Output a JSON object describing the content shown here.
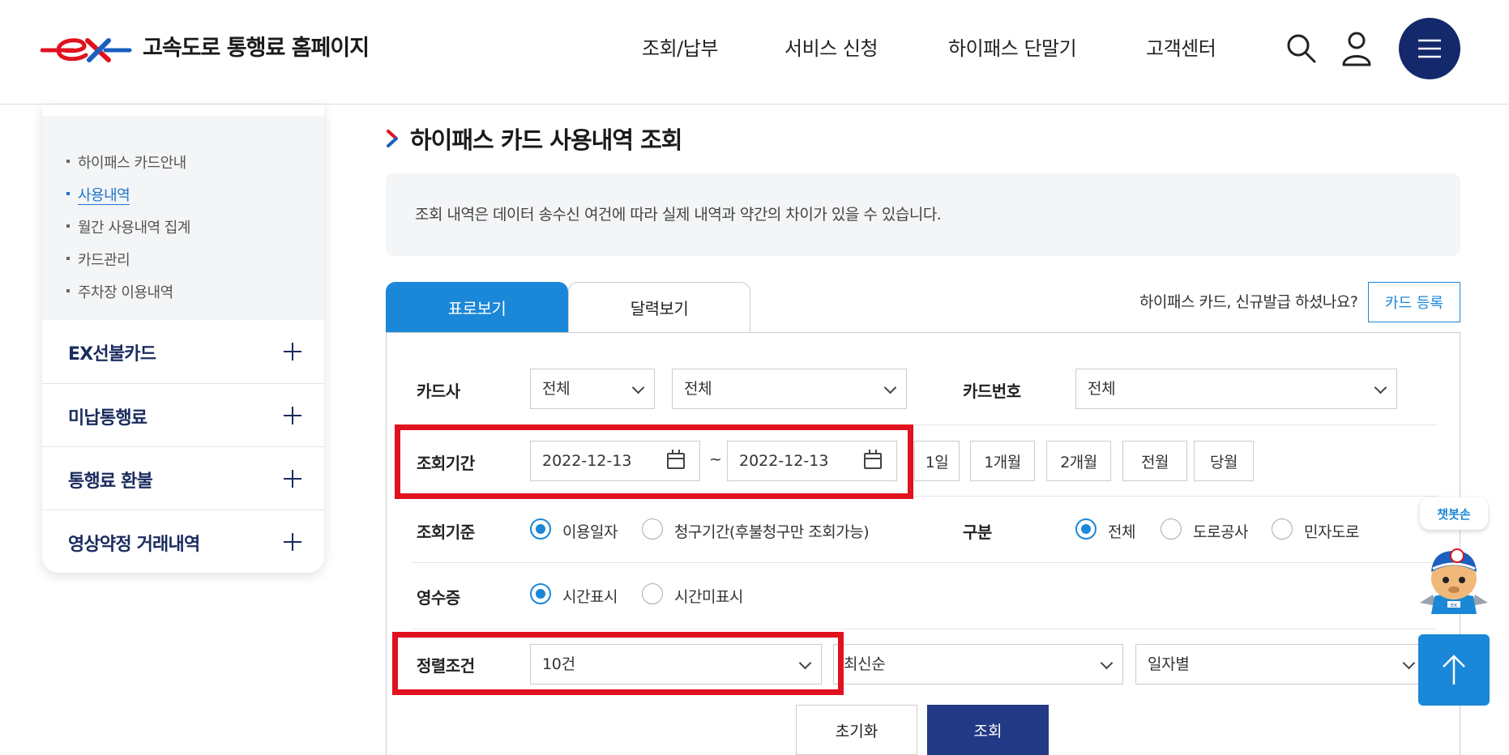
{
  "header": {
    "site_title": "고속도로 통행료 홈페이지",
    "nav": [
      "조회/납부",
      "서비스 신청",
      "하이패스 단말기",
      "고객센터"
    ]
  },
  "sidebar": {
    "sub_items": [
      "하이패스 카드안내",
      "사용내역",
      "월간 사용내역 집계",
      "카드관리",
      "주차장 이용내역"
    ],
    "active_index": 1,
    "menu": [
      "EX선불카드",
      "미납통행료",
      "통행료 환불",
      "영상약정 거래내역"
    ]
  },
  "main": {
    "title": "하이패스 카드 사용내역 조회",
    "notice": "조회 내역은 데이터 송수신 여건에 따라 실제 내역과 약간의 차이가 있을 수 있습니다.",
    "tabs": [
      "표로보기",
      "달력보기"
    ],
    "register_question": "하이패스 카드, 신규발급 하셨나요?",
    "register_button": "카드 등록"
  },
  "form": {
    "card_company_label": "카드사",
    "card_company_value": "전체",
    "card_type_value": "전체",
    "card_number_label": "카드번호",
    "card_number_value": "전체",
    "period_label": "조회기간",
    "date_from": "2022-12-13",
    "date_sep": "~",
    "date_to": "2022-12-13",
    "period_buttons": [
      "1일",
      "1개월",
      "2개월",
      "전월",
      "당월"
    ],
    "basis_label": "조회기준",
    "basis_options": [
      "이용일자",
      "청구기간(후불청구만 조회가능)"
    ],
    "category_label": "구분",
    "category_options": [
      "전체",
      "도로공사",
      "민자도로"
    ],
    "receipt_label": "영수증",
    "receipt_options": [
      "시간표시",
      "시간미표시"
    ],
    "sort_label": "정렬조건",
    "sort_count": "10건",
    "sort_order": "최신순",
    "sort_group": "일자별",
    "reset_button": "초기화",
    "search_button": "조회"
  },
  "floating": {
    "chat_label": "챗봇손",
    "mascot_badge": "ex"
  },
  "colors": {
    "brand_navy": "#14296b",
    "accent_blue": "#1b87d8",
    "highlight_red": "#e0121f",
    "search_button": "#223a85"
  }
}
